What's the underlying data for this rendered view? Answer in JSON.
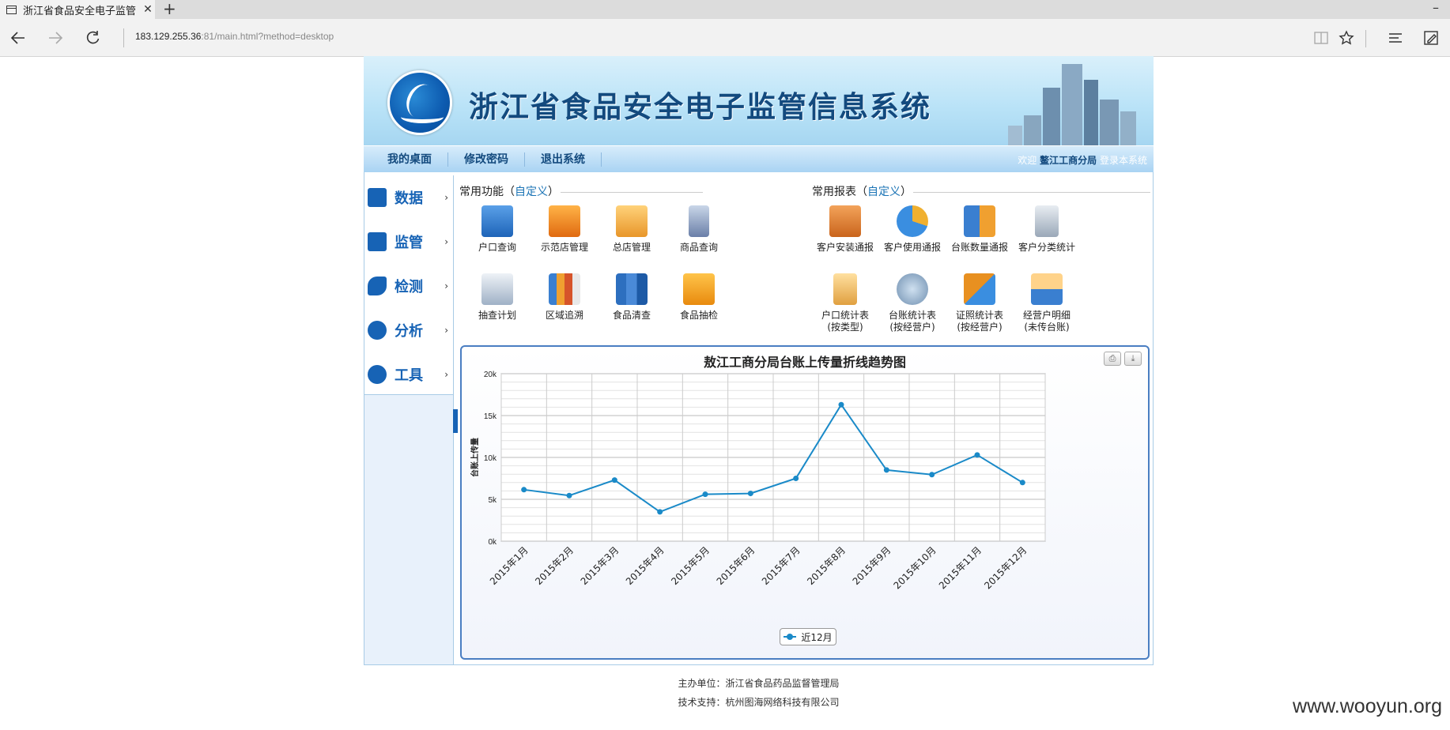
{
  "browser": {
    "tab_title": "浙江省食品安全电子监管",
    "tab_close": "✕",
    "new_tab": "+",
    "minimize": "–",
    "url_host": "183.129.255.36",
    "url_rest": ":81/main.html?method=desktop"
  },
  "banner": {
    "title": "浙江省食品安全电子监管信息系统"
  },
  "topnav": {
    "items": [
      "我的桌面",
      "修改密码",
      "退出系统"
    ],
    "welcome_prefix": "欢迎",
    "welcome_user": "鳌江工商分局",
    "welcome_suffix": "登录本系统"
  },
  "sidebar": {
    "items": [
      {
        "label": "数据",
        "icon": "edit-icon"
      },
      {
        "label": "监管",
        "icon": "book-icon"
      },
      {
        "label": "检测",
        "icon": "syringe-icon"
      },
      {
        "label": "分析",
        "icon": "pie-icon"
      },
      {
        "label": "工具",
        "icon": "gear-icon"
      }
    ],
    "arrow": "›"
  },
  "common_functions": {
    "heading": "常用功能（",
    "custom": "自定义",
    "close_paren": "）",
    "items": [
      {
        "label": "户口查询",
        "color": "#2f7fd0"
      },
      {
        "label": "示范店管理",
        "color": "#f08c1a"
      },
      {
        "label": "总店管理",
        "color": "#e8a23a"
      },
      {
        "label": "商品查询",
        "color": "#6a7fa8"
      },
      {
        "label": "抽查计划",
        "color": "#7b8fa6"
      },
      {
        "label": "区域追溯",
        "color": "#d6542a"
      },
      {
        "label": "食品清查",
        "color": "#2d6fbf"
      },
      {
        "label": "食品抽检",
        "color": "#f2a01c"
      }
    ]
  },
  "common_reports": {
    "heading": "常用报表（",
    "custom": "自定义",
    "close_paren": "）",
    "items": [
      {
        "label": "客户安装通报",
        "color": "#d8782a"
      },
      {
        "label": "客户使用通报",
        "color": "#3a8ee0"
      },
      {
        "label": "台账数量通报",
        "color": "#f0a030"
      },
      {
        "label": "客户分类统计",
        "color": "#9aa8b8"
      },
      {
        "label": "户口统计表",
        "sub": "(按类型)",
        "color": "#e0a040"
      },
      {
        "label": "台账统计表",
        "sub": "(按经营户)",
        "color": "#6f8fb0"
      },
      {
        "label": "证照统计表",
        "sub": "(按经营户)",
        "color": "#e89020"
      },
      {
        "label": "经营户明细",
        "sub": "(未传台账)",
        "color": "#e0a040"
      }
    ]
  },
  "chart_buttons": {
    "print": "⎙",
    "download": "⤓"
  },
  "chart_data": {
    "type": "line",
    "title": "敖江工商分局台账上传量折线趋势图",
    "ylabel": "台账上传量",
    "xlabel": "",
    "categories": [
      "2015年1月",
      "2015年2月",
      "2015年3月",
      "2015年4月",
      "2015年5月",
      "2015年6月",
      "2015年7月",
      "2015年8月",
      "2015年9月",
      "2015年10月",
      "2015年11月",
      "2015年12月"
    ],
    "series": [
      {
        "name": "近12月",
        "color": "#1a8ac8",
        "values": [
          6150,
          5450,
          7300,
          3500,
          5600,
          5700,
          7500,
          16300,
          8500,
          7950,
          10300,
          7000
        ]
      }
    ],
    "ylim": [
      0,
      20000
    ],
    "yticks": [
      "0k",
      "5k",
      "10k",
      "15k",
      "20k"
    ],
    "grid": true,
    "legend_position": "bottom-center"
  },
  "footer": {
    "line1": "主办单位：浙江省食品药品监督管理局",
    "line2": "技术支持：杭州图海网络科技有限公司"
  },
  "watermark": "www.wooyun.org"
}
